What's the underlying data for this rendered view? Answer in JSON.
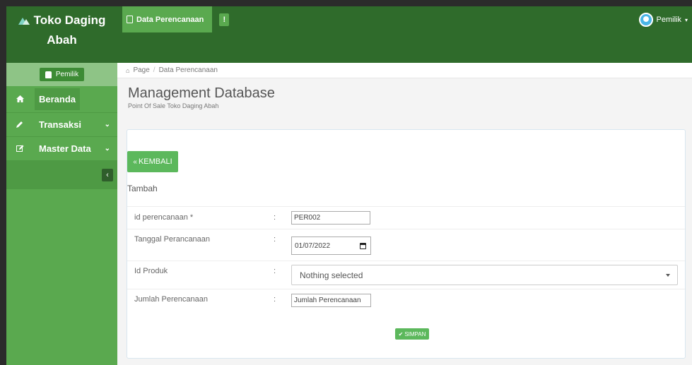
{
  "brand": {
    "line1": "Toko Daging",
    "line2": "Abah"
  },
  "sidebar": {
    "user_button": "Pemilik",
    "items": [
      {
        "label": "Beranda",
        "icon": "home-icon"
      },
      {
        "label": "Transaksi",
        "icon": "pencil-icon"
      },
      {
        "label": "Master Data",
        "icon": "edit-icon"
      }
    ],
    "collapse_symbol": "‹"
  },
  "topbar": {
    "active_tab": "Data Perencanaan",
    "small_tab": "!",
    "user_menu": "Pemilik"
  },
  "breadcrumb": {
    "root": "Page",
    "separator": "/",
    "current": "Data Perencanaan"
  },
  "page": {
    "title": "Management Database",
    "subtitle": "Point Of Sale Toko Daging Abah"
  },
  "form": {
    "back_button": "KEMBALI",
    "section_title": "Tambah",
    "fields": {
      "id_label": "id perencanaan *",
      "id_value": "PER002",
      "tanggal_label": "Tanggal Perancanaan",
      "tanggal_value": "01/07/2022",
      "produk_label": "Id Produk",
      "produk_value": "Nothing selected",
      "jumlah_label": "Jumlah Perencanaan",
      "jumlah_placeholder": "Jumlah Perencanaan"
    },
    "colon": ":",
    "submit_button": "SIMPAN"
  },
  "colors": {
    "topbar": "#2f6b2b",
    "sidebar": "#5aa94f",
    "button_green": "#5cb85c"
  }
}
